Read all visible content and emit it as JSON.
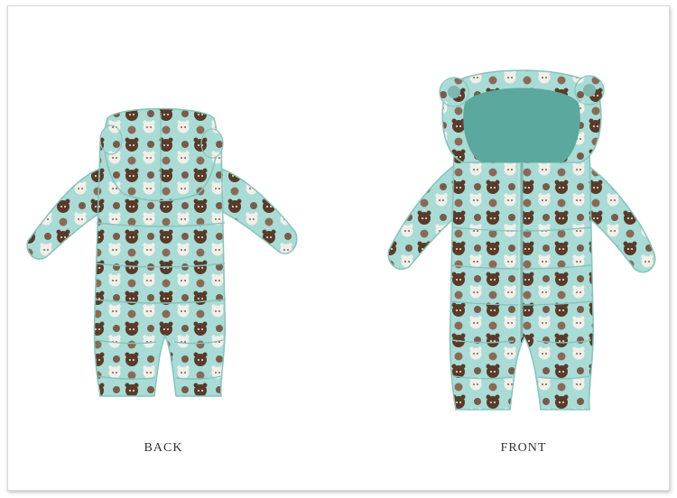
{
  "colors": {
    "fabric": "#a9dcd6",
    "fabric_shadow": "#86c4bc",
    "hood_lining": "#5aa89e",
    "bear_dark": "#5a3a28",
    "bear_light": "#f2efe8",
    "caption_text": "#333333"
  },
  "captions": {
    "back": "BACK",
    "front": "FRONT"
  },
  "images": {
    "back_view": "baby-bear-print-snowsuit-back",
    "front_view": "baby-bear-print-snowsuit-front"
  }
}
